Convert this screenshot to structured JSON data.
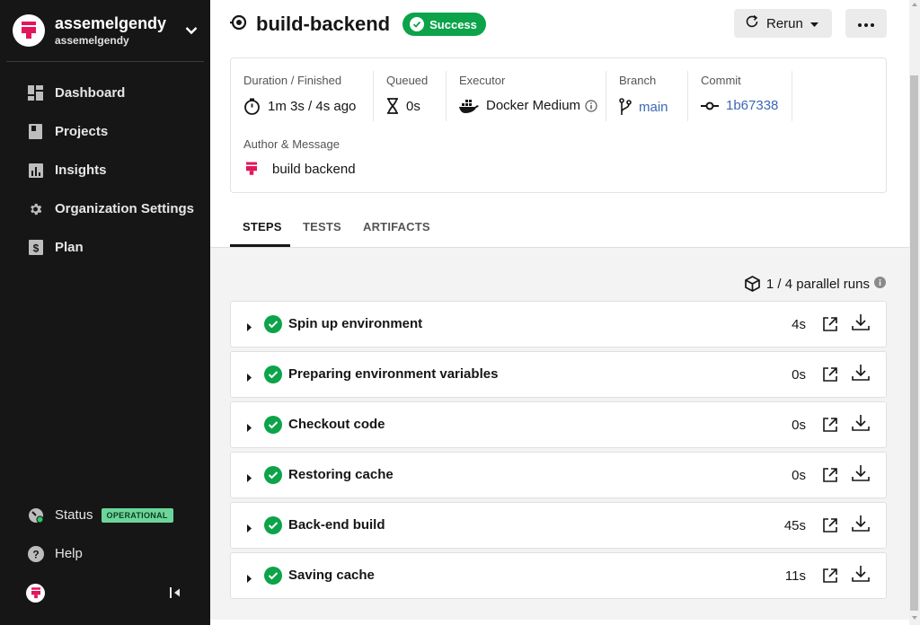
{
  "sidebar": {
    "org_name": "assemelgendy",
    "org_sub": "assemelgendy",
    "items": [
      {
        "label": "Dashboard",
        "icon": "dashboard-icon"
      },
      {
        "label": "Projects",
        "icon": "projects-icon"
      },
      {
        "label": "Insights",
        "icon": "insights-icon"
      },
      {
        "label": "Organization Settings",
        "icon": "gear-icon"
      },
      {
        "label": "Plan",
        "icon": "dollar-icon"
      }
    ],
    "status_label": "Status",
    "status_badge": "OPERATIONAL",
    "help_label": "Help"
  },
  "header": {
    "title": "build-backend",
    "badge": "Success",
    "rerun_label": "Rerun"
  },
  "info": {
    "duration_label": "Duration / Finished",
    "duration_value": "1m 3s / 4s ago",
    "queued_label": "Queued",
    "queued_value": "0s",
    "executor_label": "Executor",
    "executor_value": "Docker Medium",
    "branch_label": "Branch",
    "branch_value": "main",
    "commit_label": "Commit",
    "commit_value": "1b67338",
    "author_label": "Author & Message",
    "author_message": "build backend"
  },
  "tabs": [
    {
      "label": "STEPS"
    },
    {
      "label": "TESTS"
    },
    {
      "label": "ARTIFACTS"
    }
  ],
  "parallel_runs": "1 / 4 parallel runs",
  "steps": [
    {
      "name": "Spin up environment",
      "duration": "4s"
    },
    {
      "name": "Preparing environment variables",
      "duration": "0s"
    },
    {
      "name": "Checkout code",
      "duration": "0s"
    },
    {
      "name": "Restoring cache",
      "duration": "0s"
    },
    {
      "name": "Back-end build",
      "duration": "45s"
    },
    {
      "name": "Saving cache",
      "duration": "11s"
    }
  ],
  "colors": {
    "brand": "#e3165b",
    "success": "#0ca34a",
    "link": "#3a68b6",
    "sidebar_bg": "#161616"
  }
}
